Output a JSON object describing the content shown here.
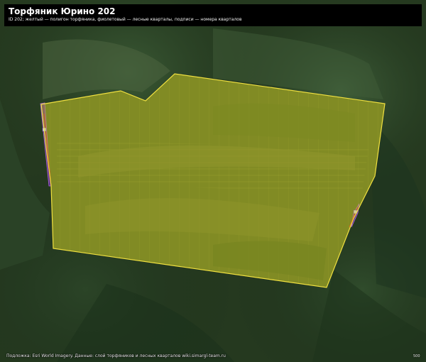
{
  "header": {
    "title": "Торфяник Юрино 202",
    "subtitle": "ID 202; желтый — полигон торфяника, фиолетовый — лесные кварталы, подписи — номера кварталов"
  },
  "footer": {
    "attribution": "Подложка: Esri World Imagery. Данные: слой торфяников и лесных кварталов wiki.simargl-team.ru",
    "scale_mark": "500"
  },
  "colors": {
    "peatland_fill": "#c8c000",
    "peatland_stroke": "#f0e040",
    "quarter_fill": "#6a2fa0",
    "quarter_stroke": "#b06ad8",
    "red_line": "#e03030",
    "forest_dark": "#1f3a1e",
    "forest_mid": "#2e4b2a",
    "clearing": "#5a6a3a"
  },
  "features": {
    "peatland_polygon": "yellow",
    "forest_quarters": "violet"
  }
}
